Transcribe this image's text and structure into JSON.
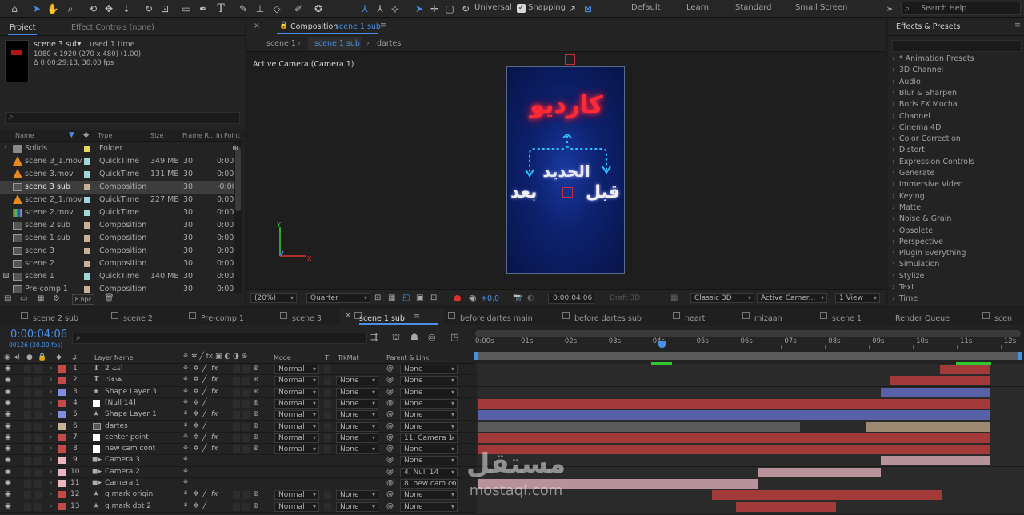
{
  "toolbar": {
    "universal": "Universal",
    "snapping": "Snapping",
    "workspaces": [
      "Default",
      "Learn",
      "Standard",
      "Small Screen"
    ],
    "search_placeholder": "Search Help"
  },
  "project": {
    "tab_project": "Project",
    "tab_effect_controls": "Effect Controls (none)",
    "item_name": "scene 3 sub",
    "item_used": ", used 1 time",
    "item_dims": "1080 x 1920  (270 x 480) (1.00)",
    "item_duration": "Δ 0:00:29:13, 30.00 fps",
    "search_placeholder": "",
    "columns": [
      "Name",
      "Type",
      "Size",
      "Frame R...",
      "In Point"
    ],
    "rows": [
      {
        "name": "Solids",
        "type": "Folder",
        "size": "",
        "fps": "",
        "in": "",
        "icon": "folder",
        "color": "#e3d55b"
      },
      {
        "name": "scene 3_1.mov",
        "type": "QuickTime",
        "size": "349 MB",
        "fps": "30",
        "in": "0:00",
        "icon": "cone",
        "color": "#a3d6d6"
      },
      {
        "name": "scene 3.mov",
        "type": "QuickTime",
        "size": "131 MB",
        "fps": "30",
        "in": "0:00",
        "icon": "cone",
        "color": "#a3d6d6"
      },
      {
        "name": "scene 3 sub",
        "type": "Composition",
        "size": "",
        "fps": "30",
        "in": "-0:00",
        "icon": "comp",
        "color": "#c7b299"
      },
      {
        "name": "scene 2_1.mov",
        "type": "QuickTime",
        "size": "227 MB",
        "fps": "30",
        "in": "0:00",
        "icon": "cone",
        "color": "#a3d6d6"
      },
      {
        "name": "scene 2.mov",
        "type": "QuickTime",
        "size": "",
        "fps": "30",
        "in": "0:00",
        "icon": "film",
        "color": "#a3d6d6"
      },
      {
        "name": "scene 2 sub",
        "type": "Composition",
        "size": "",
        "fps": "30",
        "in": "0:00",
        "icon": "comp",
        "color": "#c7b299"
      },
      {
        "name": "scene 1 sub",
        "type": "Composition",
        "size": "",
        "fps": "30",
        "in": "0:00",
        "icon": "comp",
        "color": "#c7b299"
      },
      {
        "name": "scene 3",
        "type": "Composition",
        "size": "",
        "fps": "30",
        "in": "0:00",
        "icon": "comp",
        "color": "#c7b299"
      },
      {
        "name": "scene 2",
        "type": "Composition",
        "size": "",
        "fps": "30",
        "in": "0:00",
        "icon": "comp",
        "color": "#c7b299"
      },
      {
        "name": "scene 1",
        "type": "QuickTime",
        "size": "140 MB",
        "fps": "30",
        "in": "0:00",
        "icon": "comp",
        "color": "#a3d6d6"
      },
      {
        "name": "Pre-comp 1",
        "type": "Composition",
        "size": "",
        "fps": "30",
        "in": "0:00",
        "icon": "comp",
        "color": "#c7b299"
      }
    ],
    "bpc": "8 bpc"
  },
  "composition": {
    "tab_label": "Composition",
    "tab_name": "scene 1 sub",
    "subtabs": [
      "scene 1",
      "scene 1 sub",
      "dartes"
    ],
    "camera_label": "Active Camera (Camera 1)",
    "arabic_title": "كارديو",
    "arabic_middle": "الحديد",
    "arabic_before": "قبل",
    "arabic_after": "بعد",
    "zoom": "(20%)",
    "resolution": "Quarter",
    "exposure": "+0.0",
    "timecode": "0:00:04:06",
    "draft": "Draft 3D",
    "renderer": "Classic 3D",
    "camera_select": "Active Camer...",
    "views": "1 View",
    "axis_x": "X",
    "axis_y": "Y"
  },
  "effects": {
    "title": "Effects & Presets",
    "items": [
      "* Animation Presets",
      "3D Channel",
      "Audio",
      "Blur & Sharpen",
      "Boris FX Mocha",
      "Channel",
      "Cinema 4D",
      "Color Correction",
      "Distort",
      "Expression Controls",
      "Generate",
      "Immersive Video",
      "Keying",
      "Matte",
      "Noise & Grain",
      "Obsolete",
      "Perspective",
      "Plugin Everything",
      "Simulation",
      "Stylize",
      "Text",
      "Time"
    ]
  },
  "timeline": {
    "tabs": [
      "scene 2 sub",
      "scene 2",
      "Pre-comp 1",
      "scene 3",
      "scene 1 sub",
      "before dartes main",
      "before dartes sub",
      "heart",
      "mizaan",
      "scene 1",
      "Render Queue",
      "scen"
    ],
    "timecode": "0:00:04:06",
    "frame_info": "00126 (30.00 fps)",
    "col_layer": "Layer Name",
    "col_mode": "Mode",
    "col_t": "T",
    "col_trkmat": "TrkMat",
    "col_parent": "Parent & Link",
    "col_num": "#",
    "ruler": [
      "0:00s",
      "01s",
      "02s",
      "03s",
      "04s",
      "05s",
      "06s",
      "07s",
      "08s",
      "09s",
      "10s",
      "11s",
      "12s"
    ],
    "layers": [
      {
        "num": "1",
        "name": "أنت 2",
        "type": "T",
        "color": "#c44a4a",
        "mode": "Normal",
        "trk": "",
        "parent": "None"
      },
      {
        "num": "2",
        "name": "هدفك",
        "type": "T",
        "color": "#c44a4a",
        "mode": "Normal",
        "trk": "None",
        "parent": "None"
      },
      {
        "num": "3",
        "name": "Shape Layer 3",
        "type": "star",
        "color": "#7d8ee0",
        "mode": "Normal",
        "trk": "None",
        "parent": "None"
      },
      {
        "num": "4",
        "name": "[Null 14]",
        "type": "null",
        "color": "#c44a4a",
        "mode": "Normal",
        "trk": "None",
        "parent": "None"
      },
      {
        "num": "5",
        "name": "Shape Layer 1",
        "type": "star",
        "color": "#7d8ee0",
        "mode": "Normal",
        "trk": "None",
        "parent": "None"
      },
      {
        "num": "6",
        "name": "dartes",
        "type": "comp",
        "color": "#c7b299",
        "mode": "Normal",
        "trk": "None",
        "parent": "None"
      },
      {
        "num": "7",
        "name": "center point",
        "type": "null",
        "color": "#c44a4a",
        "mode": "Normal",
        "trk": "None",
        "parent": "11. Camera 1"
      },
      {
        "num": "8",
        "name": "new cam cont",
        "type": "null",
        "color": "#c44a4a",
        "mode": "Normal",
        "trk": "None",
        "parent": "None"
      },
      {
        "num": "9",
        "name": "Camera 3",
        "type": "cam",
        "color": "#e8b5c0",
        "mode": "",
        "trk": "",
        "parent": "None"
      },
      {
        "num": "10",
        "name": "Camera 2",
        "type": "cam",
        "color": "#e8b5c0",
        "mode": "",
        "trk": "",
        "parent": "4. Null 14"
      },
      {
        "num": "11",
        "name": "Camera 1",
        "type": "cam",
        "color": "#e8b5c0",
        "mode": "",
        "trk": "",
        "parent": "8. new cam co"
      },
      {
        "num": "12",
        "name": "q mark origin",
        "type": "star",
        "color": "#c44a4a",
        "mode": "Normal",
        "trk": "None",
        "parent": "None"
      },
      {
        "num": "13",
        "name": "q mark dot 2",
        "type": "star",
        "color": "#c44a4a",
        "mode": "Normal",
        "trk": "None",
        "parent": "None"
      }
    ]
  },
  "watermark": {
    "brand_ar": "مستقل",
    "brand_en": "mostaql.com"
  }
}
